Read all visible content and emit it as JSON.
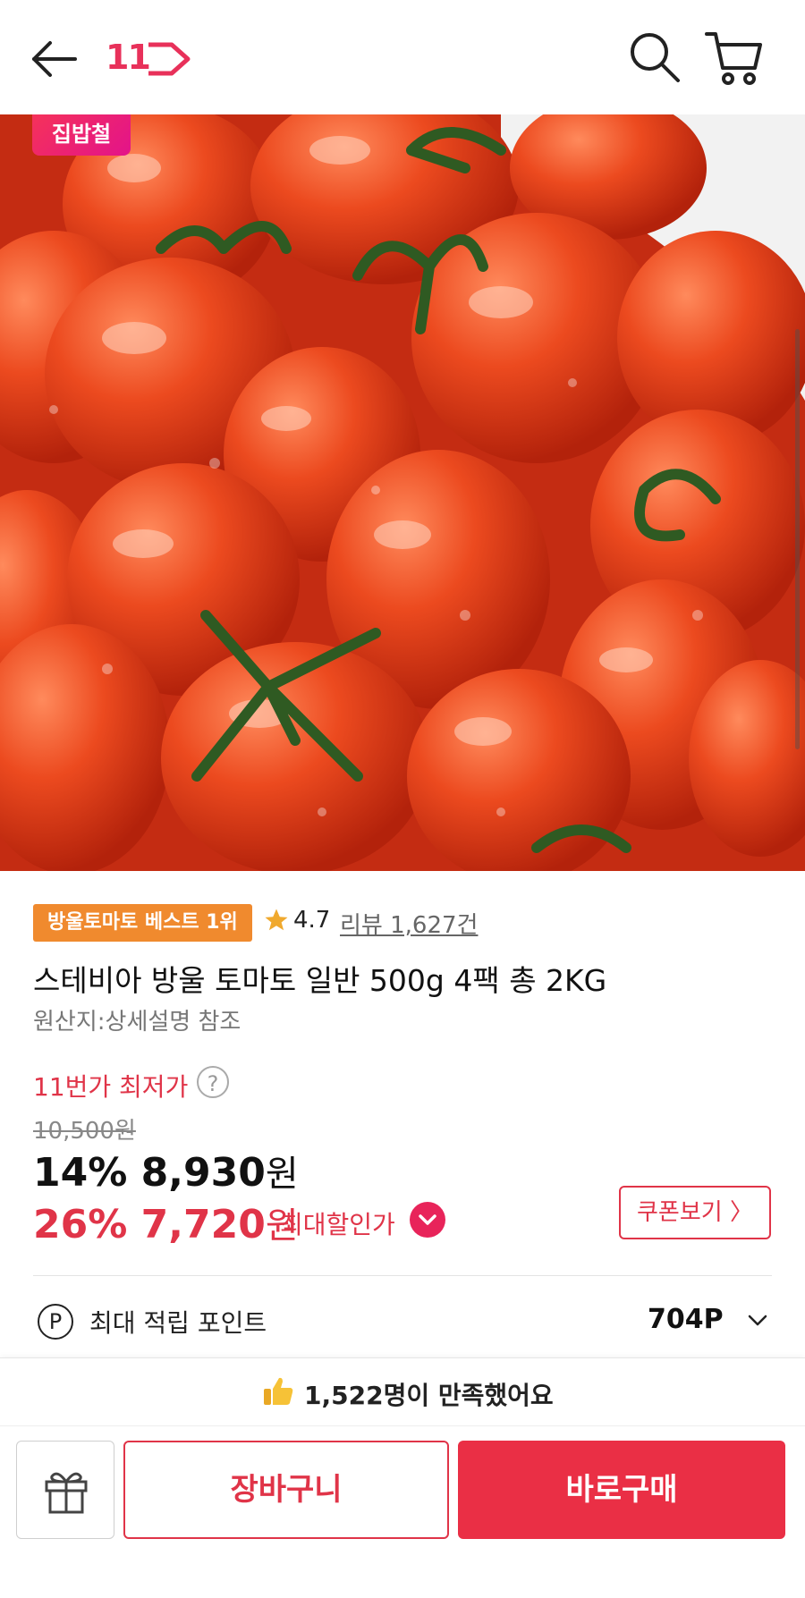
{
  "header": {
    "logo_text": "11",
    "back_icon": "arrow-left-icon",
    "search_icon": "search-icon",
    "cart_icon": "cart-icon",
    "brand_color": "#e8315a"
  },
  "hero": {
    "badge_text": "집밥철"
  },
  "product": {
    "best_badge": "방울토마토 베스트 1위",
    "rating": "4.7",
    "review_link": "리뷰 1,627건",
    "title": "스테비아 방울 토마토 일반 500g 4팩 총 2KG",
    "origin": "원산지:상세설명 참조",
    "lowest_price_label": "11번가 최저가",
    "help_symbol": "?",
    "original_price": "10,500원",
    "discount1_number": "14% 8,930",
    "discount1_unit": "원",
    "discount2_number": "26% 7,720",
    "discount2_unit": "원",
    "max_discount_label": "최대할인가",
    "coupon_button": "쿠폰보기 〉",
    "points_symbol": "P",
    "points_label": "최대 적립 포인트",
    "points_value": "704P"
  },
  "satisfaction": {
    "text": "1,522명이 만족했어요"
  },
  "actions": {
    "cart_button": "장바구니",
    "buy_button": "바로구매"
  },
  "colors": {
    "accent_red": "#e03448",
    "buy_red": "#ea2f45",
    "badge_orange": "#f08a2e"
  }
}
